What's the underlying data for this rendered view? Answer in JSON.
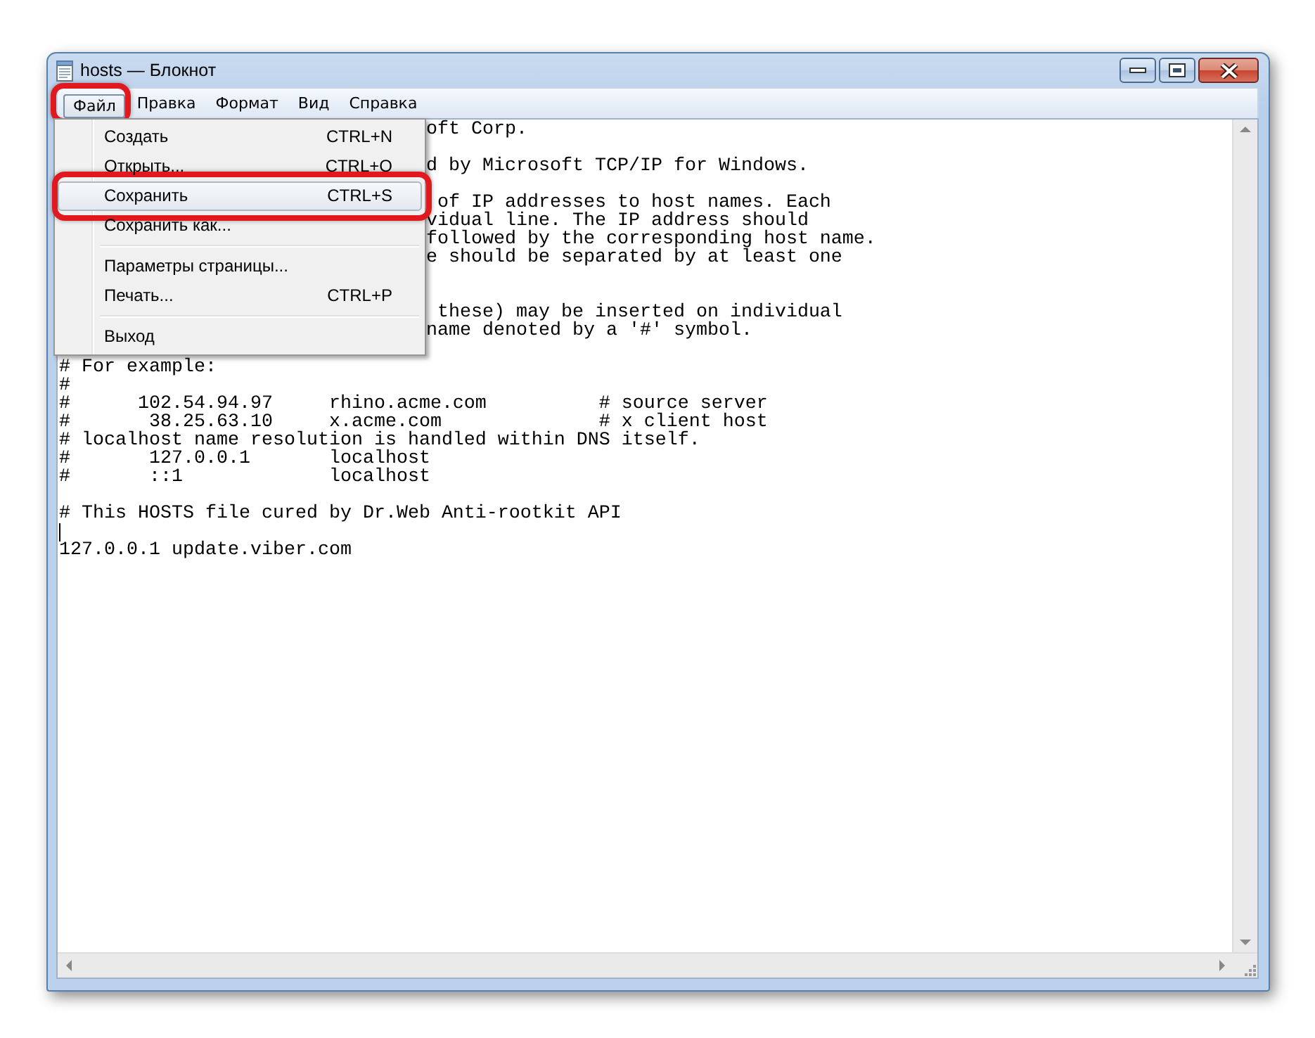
{
  "window": {
    "title": "hosts — Блокнот"
  },
  "menu_bar": [
    {
      "label": "Файл",
      "selected": true,
      "highlighted": true
    },
    {
      "label": "Правка",
      "selected": false,
      "highlighted": false
    },
    {
      "label": "Формат",
      "selected": false,
      "highlighted": false
    },
    {
      "label": "Вид",
      "selected": false,
      "highlighted": false
    },
    {
      "label": "Справка",
      "selected": false,
      "highlighted": false
    }
  ],
  "file_menu": [
    {
      "kind": "item",
      "label": "Создать",
      "shortcut": "CTRL+N",
      "selected": false,
      "highlighted": false
    },
    {
      "kind": "item",
      "label": "Открыть...",
      "shortcut": "CTRL+O",
      "selected": false,
      "highlighted": false
    },
    {
      "kind": "item",
      "label": "Сохранить",
      "shortcut": "CTRL+S",
      "selected": true,
      "highlighted": true
    },
    {
      "kind": "item",
      "label": "Сохранить как...",
      "selected": false,
      "highlighted": false
    },
    {
      "kind": "separator"
    },
    {
      "kind": "item",
      "label": "Параметры страницы...",
      "selected": false,
      "highlighted": false
    },
    {
      "kind": "item",
      "label": "Печать...",
      "shortcut": "CTRL+P",
      "selected": false,
      "highlighted": false
    },
    {
      "kind": "separator"
    },
    {
      "kind": "item",
      "label": "Выход",
      "selected": false,
      "highlighted": false
    }
  ],
  "editor": {
    "covered_text": "oft Corp.\n\nd by Microsoft TCP/IP for Windows.\n\n of IP addresses to host names. Each\nvidual line. The IP address should\nfollowed by the corresponding host name.\ne should be separated by at least one\n\n\n these) may be inserted on individual\nname denoted by a '#' symbol.",
    "text": "\n# For example:\n#\n#      102.54.94.97     rhino.acme.com          # source server\n#       38.25.63.10     x.acme.com              # x client host\n# localhost name resolution is handled within DNS itself.\n#       127.0.0.1       localhost\n#       ::1             localhost\n\n# This HOSTS file cured by Dr.Web Anti-rootkit API",
    "caret": true,
    "last_line": "127.0.0.1 update.viber.com"
  }
}
